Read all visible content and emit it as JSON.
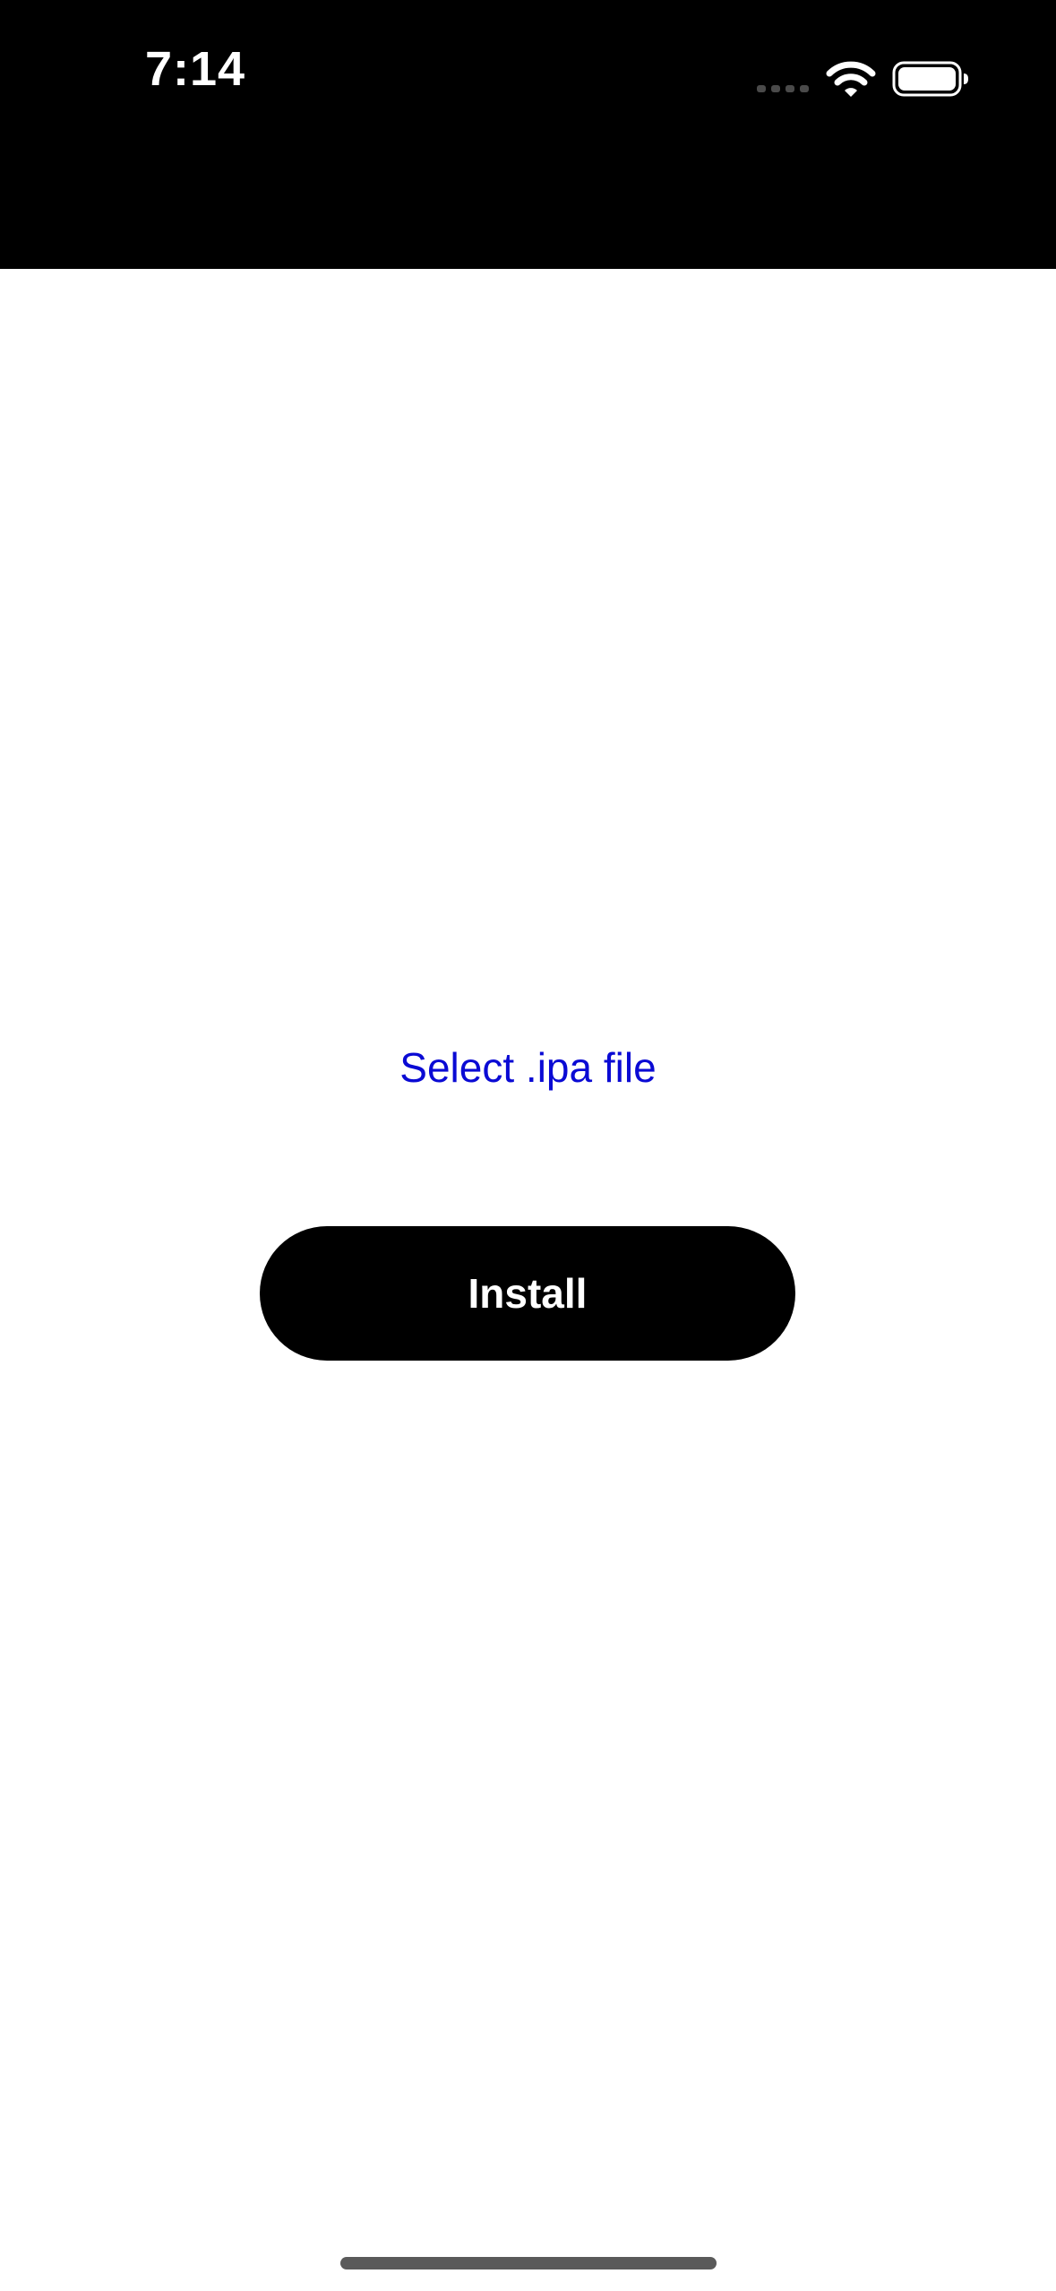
{
  "status_bar": {
    "time": "7:14",
    "icons": [
      "signal-icon",
      "wifi-icon",
      "battery-icon"
    ]
  },
  "main": {
    "select_file_label": "Select .ipa file",
    "install_button_label": "Install"
  },
  "colors": {
    "status_bar_background": "#000000",
    "page_background": "#ffffff",
    "link_color": "#0a0ad4",
    "button_background": "#000000",
    "button_text": "#ffffff",
    "home_indicator": "#5a5a5a"
  }
}
